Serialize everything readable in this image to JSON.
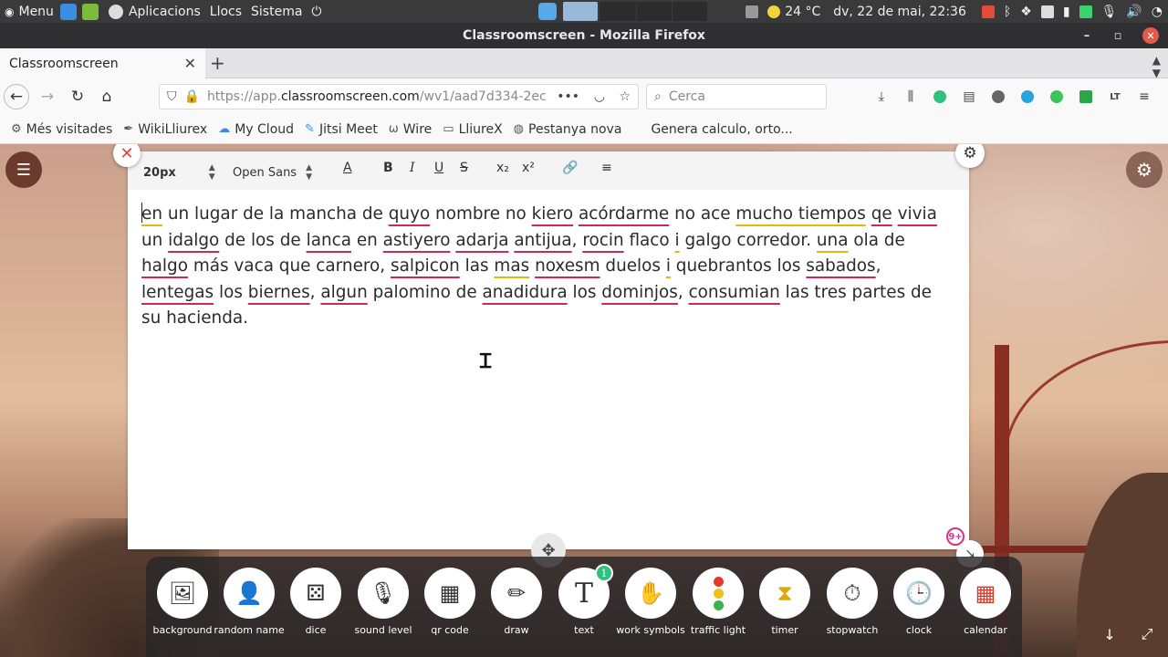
{
  "system_panel": {
    "menu_label": "Menu",
    "apps_label": "Aplicacions",
    "places_label": "Llocs",
    "system_label": "Sistema",
    "temperature": "24 °C",
    "datetime": "dv, 22 de mai, 22:36"
  },
  "window": {
    "title": "Classroomscreen - Mozilla Firefox"
  },
  "tabs": [
    {
      "label": "Classroomscreen"
    }
  ],
  "navbar": {
    "url_prefix": "https://app.",
    "url_host": "classroomscreen.com",
    "url_path": "/wv1/aad7d334-2ec",
    "search_placeholder": "Cerca"
  },
  "bookmarks": [
    {
      "label": "Més visitades",
      "icon": "gear-icon"
    },
    {
      "label": "WikiLliurex",
      "icon": "pen-icon"
    },
    {
      "label": "My Cloud",
      "icon": "cloud-icon"
    },
    {
      "label": "Jitsi Meet",
      "icon": "jitsi-icon"
    },
    {
      "label": "Wire",
      "icon": "wire-icon"
    },
    {
      "label": "LliureX",
      "icon": "folder-icon"
    },
    {
      "label": "Pestanya nova",
      "icon": "globe-icon"
    },
    {
      "label": "Genera calculo, orto...",
      "icon": ""
    }
  ],
  "editor_toolbar": {
    "font_size": "20px",
    "font_family": "Open Sans"
  },
  "editor_text": {
    "w1": "en",
    "t1": " un lugar de la mancha de ",
    "w2": "quyo",
    "t2": " nombre no ",
    "w3": "kiero",
    "t3": " ",
    "w4": "acórdarme",
    "t4": " no ace ",
    "w5": "mucho tiempos",
    "t5": " ",
    "w6": "qe",
    "t6": " ",
    "w7": "vivia",
    "t7": " un ",
    "w8": "idalgo",
    "t8": " de los de ",
    "w9": "lanca",
    "t9": " en ",
    "w10": "astiyero",
    "t10": " ",
    "w11": "adarja",
    "t11": " ",
    "w12": "antijua",
    "t12": ", ",
    "w13": "rocin",
    "t13": " flaco ",
    "w14": "i",
    "t14": " galgo corredor. ",
    "w15": "una",
    "t15": " ola de ",
    "w16": "halgo",
    "t16": " más vaca que carnero, ",
    "w17": "salpicon",
    "t17": " las ",
    "w18": "mas",
    "t18": " ",
    "w19": "noxesm",
    "t19": " duelos ",
    "w20": "i",
    "t20": " quebrantos los ",
    "w21": "sabados",
    "t21": ", ",
    "w22": "lentegas",
    "t22": " los ",
    "w23": "biernes",
    "t23": ", ",
    "w24": "algun",
    "t24": " palomino de ",
    "w25": "anadidura",
    "t25": " los ",
    "w26": "dominjos",
    "t26": ", ",
    "w27": "consumian",
    "t27": " las tres partes de su hacienda."
  },
  "widget": {
    "badge": "9+"
  },
  "dock": [
    {
      "label": "background",
      "icon": "image-icon"
    },
    {
      "label": "random name",
      "icon": "person-shuffle-icon"
    },
    {
      "label": "dice",
      "icon": "dice-icon"
    },
    {
      "label": "sound level",
      "icon": "microphone-icon"
    },
    {
      "label": "qr code",
      "icon": "qr-icon"
    },
    {
      "label": "draw",
      "icon": "pencil-icon"
    },
    {
      "label": "text",
      "icon": "text-icon",
      "badge": "1"
    },
    {
      "label": "work symbols",
      "icon": "work-symbols-icon"
    },
    {
      "label": "traffic light",
      "icon": "traffic-light-icon"
    },
    {
      "label": "timer",
      "icon": "hourglass-icon"
    },
    {
      "label": "stopwatch",
      "icon": "stopwatch-icon"
    },
    {
      "label": "clock",
      "icon": "clock-icon"
    },
    {
      "label": "calendar",
      "icon": "calendar-icon"
    }
  ],
  "colors": {
    "spelling_underline": "#d0275a",
    "grammar_underline": "#e2b70f",
    "badge_green": "#2ec27e",
    "close_red": "#e8403a"
  }
}
